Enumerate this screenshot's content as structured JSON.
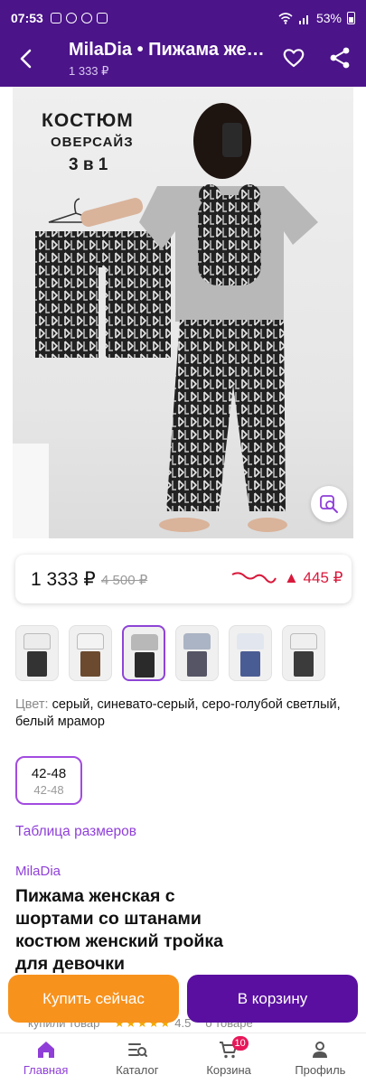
{
  "status_bar": {
    "time": "07:53",
    "battery": "53%",
    "left_icons": [
      "photo-icon",
      "viber-icon",
      "whatsapp-icon",
      "screen-record-icon"
    ]
  },
  "header": {
    "title": "MilaDia • Пижама женская с шортами со штанами",
    "price": "1 333 ₽",
    "color": "#4b1489"
  },
  "photo": {
    "caption_line1": "КОСТЮМ",
    "caption_line2": "ОВЕРСАЙЗ",
    "caption_line3": "3 в 1"
  },
  "price_box": {
    "current": "1 333 ₽",
    "old": "4 500 ₽",
    "change": "▲ 445 ₽",
    "change_color": "#d8193b"
  },
  "thumbnails": {
    "count": 6,
    "selected_index": 2
  },
  "color_info": {
    "label": "Цвет:",
    "value": "серый, синевато-серый, серо-голубой светлый, белый мрамор"
  },
  "size_option": {
    "primary": "42-48",
    "secondary": "42-48"
  },
  "size_table_link": "Таблица размеров",
  "brand": "MilaDia",
  "product_title": "Пижама женская с шортами со штанами костюм женский тройка для девочки",
  "peek_row": {
    "left": "купили товар",
    "rating": "4.5",
    "right": "о товаре"
  },
  "actions": {
    "buy_now": "Купить сейчас",
    "add_to_cart": "В корзину",
    "buy_color": "#f7921d",
    "cart_color": "#5a0fa1"
  },
  "bottom_nav": {
    "items": [
      {
        "label": "Главная",
        "icon": "home-icon"
      },
      {
        "label": "Каталог",
        "icon": "catalog-icon"
      },
      {
        "label": "Корзина",
        "icon": "cart-icon",
        "badge": "10"
      },
      {
        "label": "Профиль",
        "icon": "profile-icon"
      }
    ],
    "active_index": 0,
    "accent": "#8f3fd8"
  }
}
